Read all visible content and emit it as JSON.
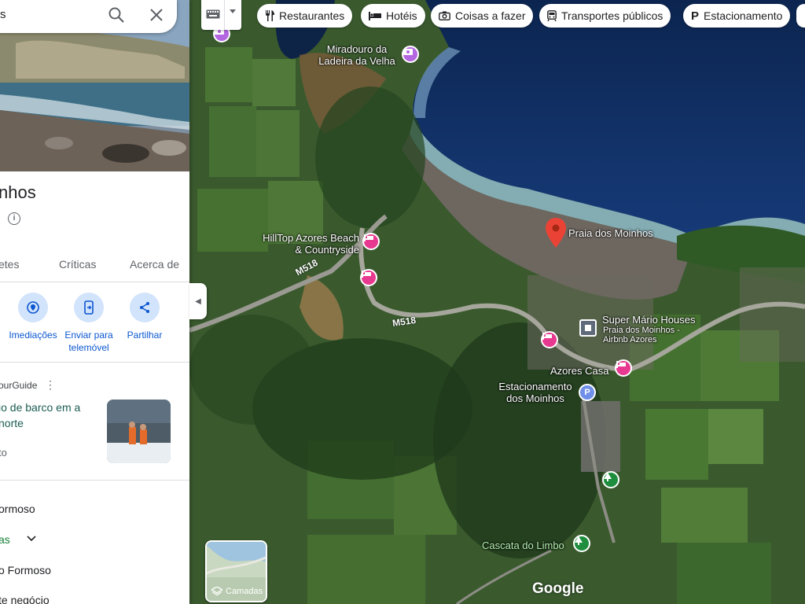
{
  "search": {
    "value": "s"
  },
  "place": {
    "title": "nhos",
    "info_prefix": ")"
  },
  "tabs": [
    "etes",
    "Críticas",
    "Acerca de"
  ],
  "actions": [
    {
      "label": "Imediações",
      "icon": "nearby-icon"
    },
    {
      "label": "Enviar para telemóvel",
      "icon": "send-to-phone-icon"
    },
    {
      "label": "Partilhar",
      "icon": "share-icon"
    }
  ],
  "guide": {
    "source": "ourGuide",
    "title": "io de barco em a norte",
    "subtitle": "to"
  },
  "list": {
    "line1": "ormoso",
    "line2": "as",
    "line3": "o Formoso",
    "line4": "te negócio"
  },
  "map_chips": [
    {
      "label": "Restaurantes",
      "icon": "restaurant-icon"
    },
    {
      "label": "Hotéis",
      "icon": "hotel-icon"
    },
    {
      "label": "Coisas a fazer",
      "icon": "camera-icon"
    },
    {
      "label": "Transportes públicos",
      "icon": "transit-icon"
    },
    {
      "label": "Estacionamento",
      "icon": "parking-icon"
    }
  ],
  "map_labels": {
    "miradouro": "Miradouro da Ladeira da Velha",
    "praia": "Praia dos Moinhos",
    "hilltop": "HillTop Azores Beach & Countryside",
    "super_mario": "Super Mário Houses",
    "super_mario_sub": "Praia dos Moinhos - Airbnb Azores",
    "azores_casa": "Azores Casa",
    "estacionamento": "Estacionamento dos Moinhos",
    "cascata": "Cascata do Limbo",
    "road1": "M518",
    "road2": "M518"
  },
  "layers_label": "Camadas",
  "brand": "Google",
  "colors": {
    "accent": "#0b57d0",
    "hotel_pin": "#e7398f",
    "red_pin": "#ea4335",
    "park_pin": "#1e8e3e"
  }
}
